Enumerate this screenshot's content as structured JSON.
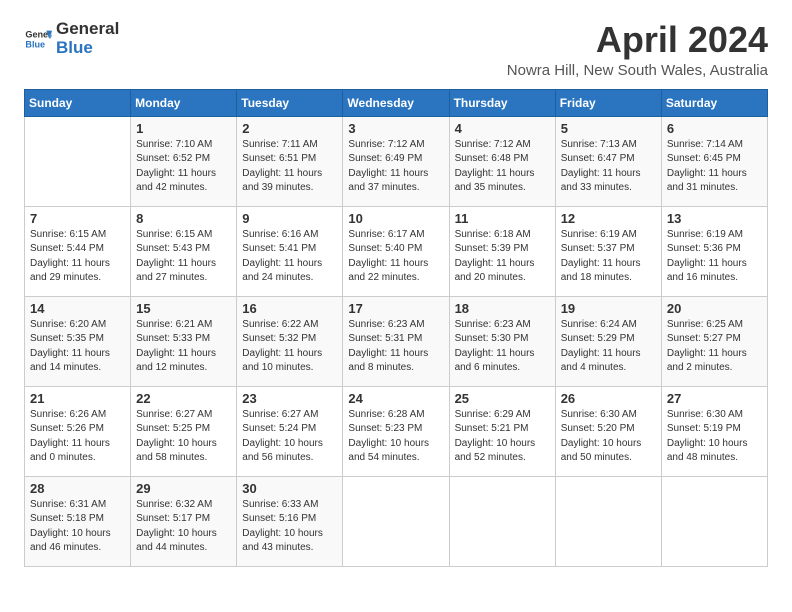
{
  "header": {
    "logo_general": "General",
    "logo_blue": "Blue",
    "title": "April 2024",
    "location": "Nowra Hill, New South Wales, Australia"
  },
  "columns": [
    "Sunday",
    "Monday",
    "Tuesday",
    "Wednesday",
    "Thursday",
    "Friday",
    "Saturday"
  ],
  "weeks": [
    [
      {
        "day": "",
        "info": ""
      },
      {
        "day": "1",
        "info": "Sunrise: 7:10 AM\nSunset: 6:52 PM\nDaylight: 11 hours\nand 42 minutes."
      },
      {
        "day": "2",
        "info": "Sunrise: 7:11 AM\nSunset: 6:51 PM\nDaylight: 11 hours\nand 39 minutes."
      },
      {
        "day": "3",
        "info": "Sunrise: 7:12 AM\nSunset: 6:49 PM\nDaylight: 11 hours\nand 37 minutes."
      },
      {
        "day": "4",
        "info": "Sunrise: 7:12 AM\nSunset: 6:48 PM\nDaylight: 11 hours\nand 35 minutes."
      },
      {
        "day": "5",
        "info": "Sunrise: 7:13 AM\nSunset: 6:47 PM\nDaylight: 11 hours\nand 33 minutes."
      },
      {
        "day": "6",
        "info": "Sunrise: 7:14 AM\nSunset: 6:45 PM\nDaylight: 11 hours\nand 31 minutes."
      }
    ],
    [
      {
        "day": "7",
        "info": "Sunrise: 6:15 AM\nSunset: 5:44 PM\nDaylight: 11 hours\nand 29 minutes."
      },
      {
        "day": "8",
        "info": "Sunrise: 6:15 AM\nSunset: 5:43 PM\nDaylight: 11 hours\nand 27 minutes."
      },
      {
        "day": "9",
        "info": "Sunrise: 6:16 AM\nSunset: 5:41 PM\nDaylight: 11 hours\nand 24 minutes."
      },
      {
        "day": "10",
        "info": "Sunrise: 6:17 AM\nSunset: 5:40 PM\nDaylight: 11 hours\nand 22 minutes."
      },
      {
        "day": "11",
        "info": "Sunrise: 6:18 AM\nSunset: 5:39 PM\nDaylight: 11 hours\nand 20 minutes."
      },
      {
        "day": "12",
        "info": "Sunrise: 6:19 AM\nSunset: 5:37 PM\nDaylight: 11 hours\nand 18 minutes."
      },
      {
        "day": "13",
        "info": "Sunrise: 6:19 AM\nSunset: 5:36 PM\nDaylight: 11 hours\nand 16 minutes."
      }
    ],
    [
      {
        "day": "14",
        "info": "Sunrise: 6:20 AM\nSunset: 5:35 PM\nDaylight: 11 hours\nand 14 minutes."
      },
      {
        "day": "15",
        "info": "Sunrise: 6:21 AM\nSunset: 5:33 PM\nDaylight: 11 hours\nand 12 minutes."
      },
      {
        "day": "16",
        "info": "Sunrise: 6:22 AM\nSunset: 5:32 PM\nDaylight: 11 hours\nand 10 minutes."
      },
      {
        "day": "17",
        "info": "Sunrise: 6:23 AM\nSunset: 5:31 PM\nDaylight: 11 hours\nand 8 minutes."
      },
      {
        "day": "18",
        "info": "Sunrise: 6:23 AM\nSunset: 5:30 PM\nDaylight: 11 hours\nand 6 minutes."
      },
      {
        "day": "19",
        "info": "Sunrise: 6:24 AM\nSunset: 5:29 PM\nDaylight: 11 hours\nand 4 minutes."
      },
      {
        "day": "20",
        "info": "Sunrise: 6:25 AM\nSunset: 5:27 PM\nDaylight: 11 hours\nand 2 minutes."
      }
    ],
    [
      {
        "day": "21",
        "info": "Sunrise: 6:26 AM\nSunset: 5:26 PM\nDaylight: 11 hours\nand 0 minutes."
      },
      {
        "day": "22",
        "info": "Sunrise: 6:27 AM\nSunset: 5:25 PM\nDaylight: 10 hours\nand 58 minutes."
      },
      {
        "day": "23",
        "info": "Sunrise: 6:27 AM\nSunset: 5:24 PM\nDaylight: 10 hours\nand 56 minutes."
      },
      {
        "day": "24",
        "info": "Sunrise: 6:28 AM\nSunset: 5:23 PM\nDaylight: 10 hours\nand 54 minutes."
      },
      {
        "day": "25",
        "info": "Sunrise: 6:29 AM\nSunset: 5:21 PM\nDaylight: 10 hours\nand 52 minutes."
      },
      {
        "day": "26",
        "info": "Sunrise: 6:30 AM\nSunset: 5:20 PM\nDaylight: 10 hours\nand 50 minutes."
      },
      {
        "day": "27",
        "info": "Sunrise: 6:30 AM\nSunset: 5:19 PM\nDaylight: 10 hours\nand 48 minutes."
      }
    ],
    [
      {
        "day": "28",
        "info": "Sunrise: 6:31 AM\nSunset: 5:18 PM\nDaylight: 10 hours\nand 46 minutes."
      },
      {
        "day": "29",
        "info": "Sunrise: 6:32 AM\nSunset: 5:17 PM\nDaylight: 10 hours\nand 44 minutes."
      },
      {
        "day": "30",
        "info": "Sunrise: 6:33 AM\nSunset: 5:16 PM\nDaylight: 10 hours\nand 43 minutes."
      },
      {
        "day": "",
        "info": ""
      },
      {
        "day": "",
        "info": ""
      },
      {
        "day": "",
        "info": ""
      },
      {
        "day": "",
        "info": ""
      }
    ]
  ]
}
